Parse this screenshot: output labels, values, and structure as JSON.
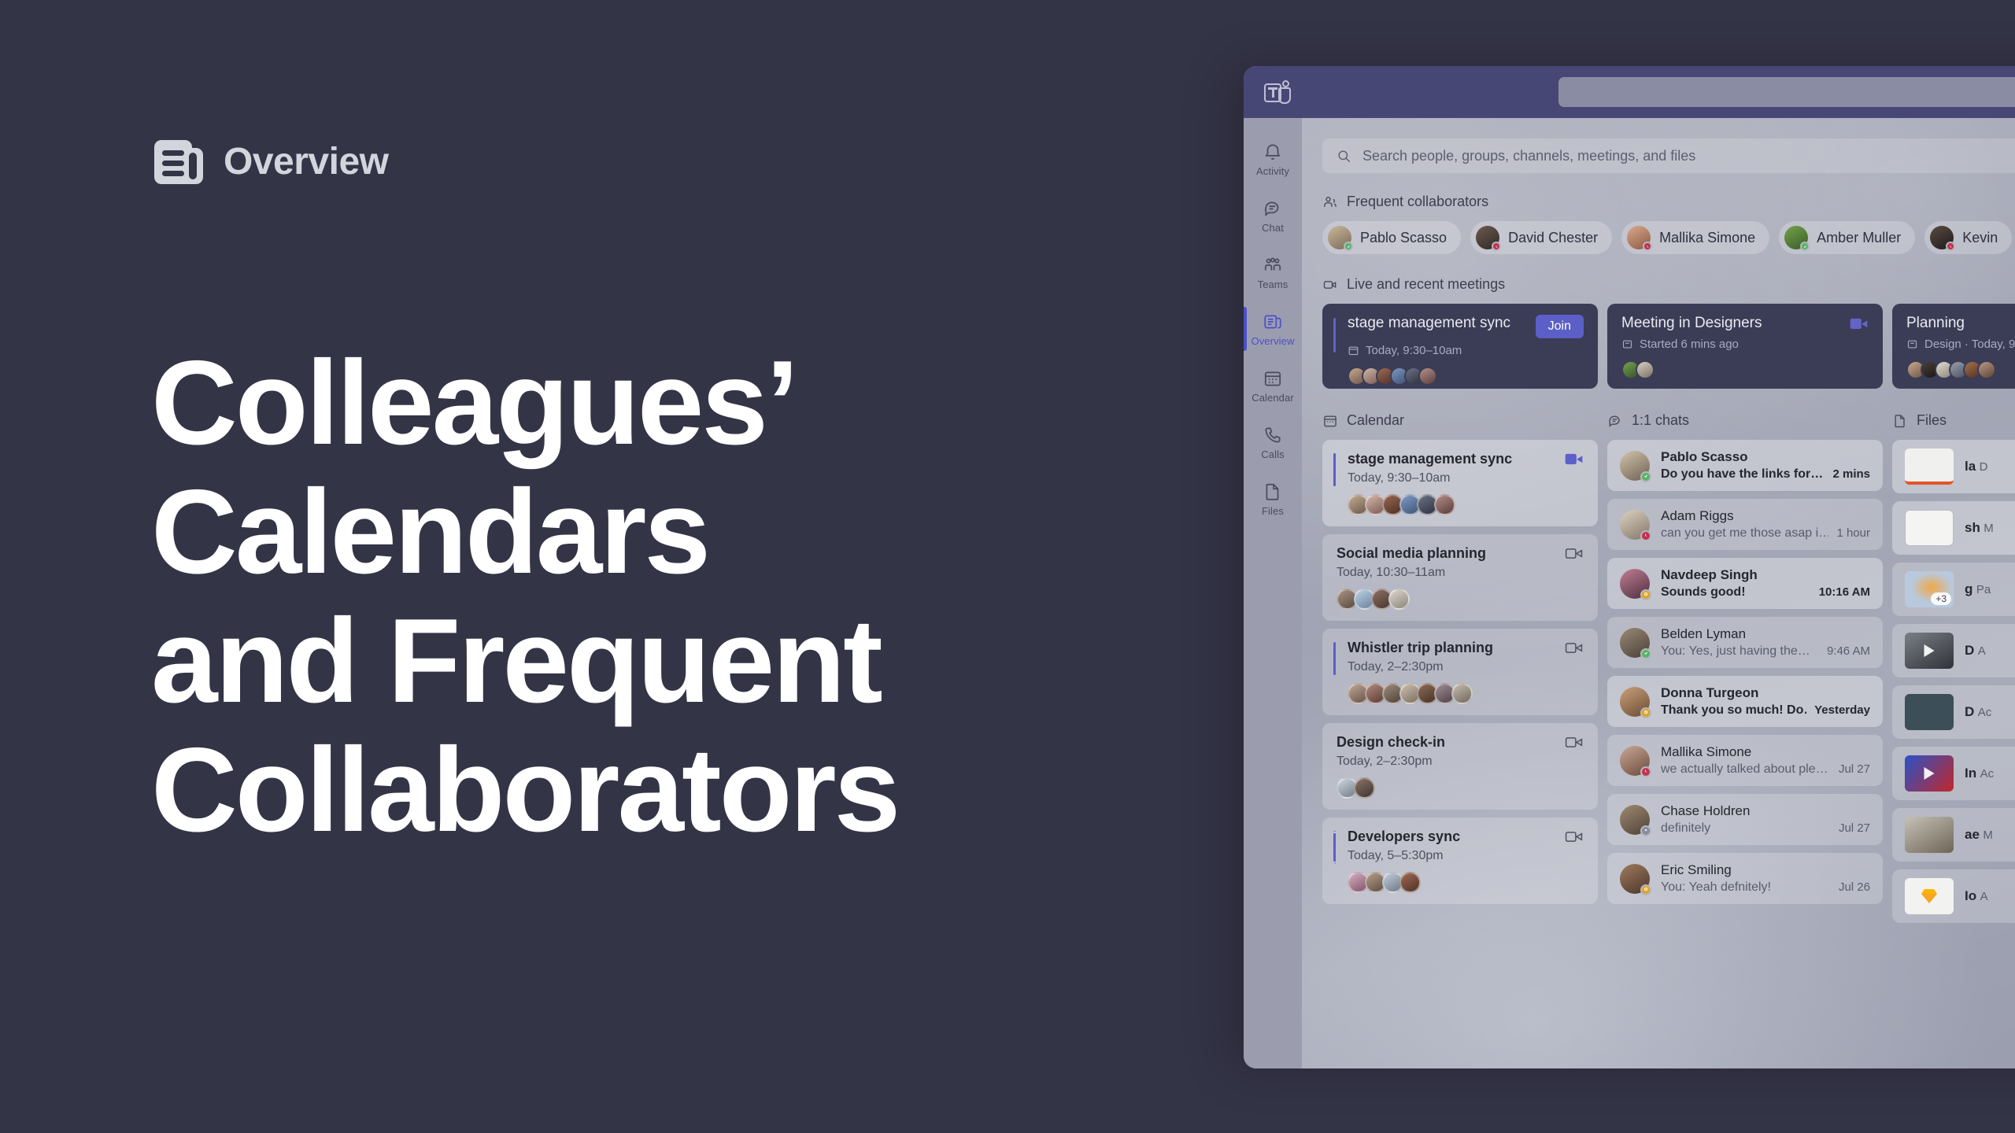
{
  "slide": {
    "eyebrow_label": "Overview",
    "eyebrow_icon": "overview-feed-icon",
    "headline_line1": "Colleagues’",
    "headline_line2": "Calendars",
    "headline_line3": "and Frequent",
    "headline_line4": "Collaborators",
    "background_color": "#343447",
    "headline_color": "#ffffff",
    "eyebrow_color": "#d3d5dd"
  },
  "app": {
    "titlebar": {
      "logo_icon": "microsoft-teams-logo",
      "search_box_placeholder": "",
      "background_color": "#464775"
    },
    "rail": {
      "items": [
        {
          "label": "Activity",
          "icon": "bell-icon",
          "active": false
        },
        {
          "label": "Chat",
          "icon": "chat-bubble-icon",
          "active": false
        },
        {
          "label": "Teams",
          "icon": "people-group-icon",
          "active": false
        },
        {
          "label": "Overview",
          "icon": "overview-feed-icon",
          "active": true
        },
        {
          "label": "Calendar",
          "icon": "calendar-icon",
          "active": false
        },
        {
          "label": "Calls",
          "icon": "phone-icon",
          "active": false
        },
        {
          "label": "Files",
          "icon": "file-icon",
          "active": false
        }
      ],
      "active_color": "#4c50c8"
    },
    "search": {
      "icon": "search-icon",
      "placeholder": "Search people, groups, channels, meetings, and files"
    },
    "collaborators_section": {
      "icon": "people-icon",
      "title": "Frequent collaborators",
      "people": [
        {
          "name": "Pablo Scasso",
          "presence": "available"
        },
        {
          "name": "David Chester",
          "presence": "busy"
        },
        {
          "name": "Mallika Simone",
          "presence": "busy"
        },
        {
          "name": "Amber Muller",
          "presence": "available"
        },
        {
          "name": "Kevin",
          "presence": "busy"
        }
      ]
    },
    "meetings_section": {
      "icon": "video-camera-icon",
      "title": "Live and recent meetings",
      "cards": [
        {
          "title": "stage management sync",
          "sub_icon": "calendar-icon",
          "subtitle": "Today, 9:30–10am",
          "action_label": "Join",
          "has_accent": true,
          "attendee_count": 6
        },
        {
          "title": "Meeting in Designers",
          "sub_icon": "channel-icon",
          "subtitle": "Started 6 mins ago",
          "action_icon": "video-camera-filled-icon",
          "has_accent": false,
          "attendee_count": 2
        },
        {
          "title": "Planning",
          "sub_icon": "channel-icon",
          "subtitle": "Design · Today, 9",
          "has_accent": false,
          "attendee_count": 6
        }
      ]
    },
    "calendar_column": {
      "icon": "calendar-icon",
      "title": "Calendar",
      "events": [
        {
          "title": "stage management sync",
          "time": "Today, 9:30–10am",
          "accent": "solid",
          "camera": "filled",
          "attendee_count": 6,
          "highlight": true
        },
        {
          "title": "Social media planning",
          "time": "Today, 10:30–11am",
          "accent": "none",
          "camera": "outline",
          "attendee_count": 4,
          "highlight": false
        },
        {
          "title": "Whistler trip planning",
          "time": "Today, 2–2:30pm",
          "accent": "solid",
          "camera": "outline",
          "attendee_count": 7,
          "highlight": false
        },
        {
          "title": "Design check-in",
          "time": "Today, 2–2:30pm",
          "accent": "none",
          "camera": "outline",
          "attendee_count": 2,
          "highlight": false
        },
        {
          "title": "Developers sync",
          "time": "Today, 5–5:30pm",
          "accent": "dashed",
          "camera": "outline",
          "attendee_count": 4,
          "highlight": false
        }
      ]
    },
    "chats_column": {
      "icon": "chat-bubble-icon",
      "title": "1:1 chats",
      "chats": [
        {
          "name": "Pablo Scasso",
          "message": "Do you have the links for…",
          "time": "2 mins",
          "unread": true,
          "presence": "available"
        },
        {
          "name": "Adam Riggs",
          "message": "can you get me those asap i…",
          "time": "1 hour",
          "unread": false,
          "presence": "busy"
        },
        {
          "name": "Navdeep Singh",
          "message": "Sounds good!",
          "time": "10:16 AM",
          "unread": true,
          "presence": "away"
        },
        {
          "name": "Belden Lyman",
          "message": "You: Yes, just having the…",
          "time": "9:46 AM",
          "unread": false,
          "presence": "available"
        },
        {
          "name": "Donna Turgeon",
          "message": "Thank you so much! Do…",
          "time": "Yesterday",
          "unread": true,
          "presence": "away"
        },
        {
          "name": "Mallika Simone",
          "message": "we actually talked about ple…",
          "time": "Jul 27",
          "unread": false,
          "presence": "busy"
        },
        {
          "name": "Chase Holdren",
          "message": "definitely",
          "time": "Jul 27",
          "unread": false,
          "presence": "offline"
        },
        {
          "name": "Eric Smiling",
          "message": "You: Yeah defnitely!",
          "time": "Jul 26",
          "unread": false,
          "presence": "away"
        }
      ]
    },
    "files_column": {
      "icon": "file-icon",
      "title": "Files",
      "files": [
        {
          "name": "la",
          "sub": "D",
          "thumb": "document",
          "badge": ""
        },
        {
          "name": "sh",
          "sub": "M",
          "thumb": "wireframe",
          "badge": ""
        },
        {
          "name": "g",
          "sub": "Pa",
          "thumb": "gradient",
          "badge": "+3"
        },
        {
          "name": "D",
          "sub": "A",
          "thumb": "video-desk",
          "badge": ""
        },
        {
          "name": "D",
          "sub": "Ac",
          "thumb": "dark",
          "badge": ""
        },
        {
          "name": "In",
          "sub": "Ac",
          "thumb": "video-red",
          "badge": ""
        },
        {
          "name": "ae",
          "sub": "M",
          "thumb": "photo-person",
          "badge": ""
        },
        {
          "name": "Io",
          "sub": "A",
          "thumb": "sketch",
          "badge": ""
        }
      ]
    }
  }
}
